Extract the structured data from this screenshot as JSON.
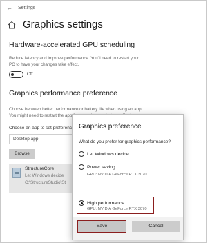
{
  "window": {
    "title": "Settings"
  },
  "header": {
    "title": "Graphics settings"
  },
  "gpu_scheduling": {
    "title": "Hardware-accelerated GPU scheduling",
    "description_line1": "Reduce latency and improve performance. You'll need to restart your",
    "description_line2": "PC to have your changes take effect.",
    "toggle_label": "Off"
  },
  "performance_pref": {
    "title": "Graphics performance preference",
    "description_line1": "Choose between better performance or battery life when using an app.",
    "description_line2": "You might need to restart the app for your changes to take effect.",
    "choose_label": "Choose an app to set preference",
    "dropdown_value": "Desktop app",
    "browse_label": "Browse"
  },
  "app_item": {
    "name": "StructureCore",
    "preference": "Let Windows decide",
    "path": "C:\\StructureStudio\\St"
  },
  "dialog": {
    "title": "Graphics preference",
    "question": "What do you prefer for graphics performance?",
    "options": [
      {
        "label": "Let Windows decide",
        "gpu": ""
      },
      {
        "label": "Power saving",
        "gpu": "GPU: NVIDIA GeForce RTX 3070"
      },
      {
        "label": "High performance",
        "gpu": "GPU: NVIDIA GeForce RTX 3070"
      }
    ],
    "selected": "High performance",
    "save_label": "Save",
    "cancel_label": "Cancel"
  },
  "colors": {
    "highlight": "#8b1e1e"
  }
}
